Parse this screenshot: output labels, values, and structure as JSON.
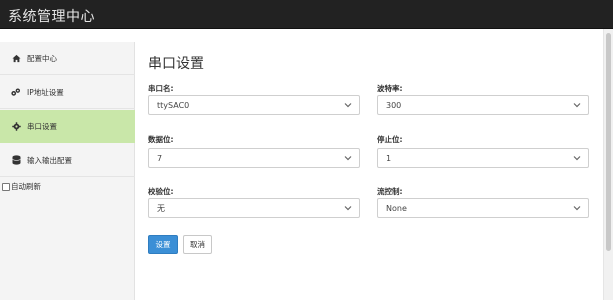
{
  "app": {
    "title": "系统管理中心"
  },
  "sidebar": {
    "items": [
      {
        "label": "配置中心",
        "icon": "home-icon"
      },
      {
        "label": "IP地址设置",
        "icon": "network-icon"
      },
      {
        "label": "串口设置",
        "icon": "gear-icon",
        "active": true
      },
      {
        "label": "输入输出配置",
        "icon": "database-icon"
      }
    ],
    "auto_refresh": {
      "label": "自动刷新",
      "checked": false
    }
  },
  "main": {
    "title": "串口设置",
    "fields": {
      "port_name": {
        "label": "串口名:",
        "value": "ttySAC0"
      },
      "baud_rate": {
        "label": "波特率:",
        "value": "300"
      },
      "data_bits": {
        "label": "数据位:",
        "value": "7"
      },
      "stop_bits": {
        "label": "停止位:",
        "value": "1"
      },
      "parity": {
        "label": "校验位:",
        "value": "无"
      },
      "flow_control": {
        "label": "流控制:",
        "value": "None"
      }
    },
    "buttons": {
      "submit": "设置",
      "cancel": "取消"
    }
  },
  "colors": {
    "topbar": "#222222",
    "active_nav": "#c9e7a9",
    "primary_button": "#3b8fd6"
  }
}
